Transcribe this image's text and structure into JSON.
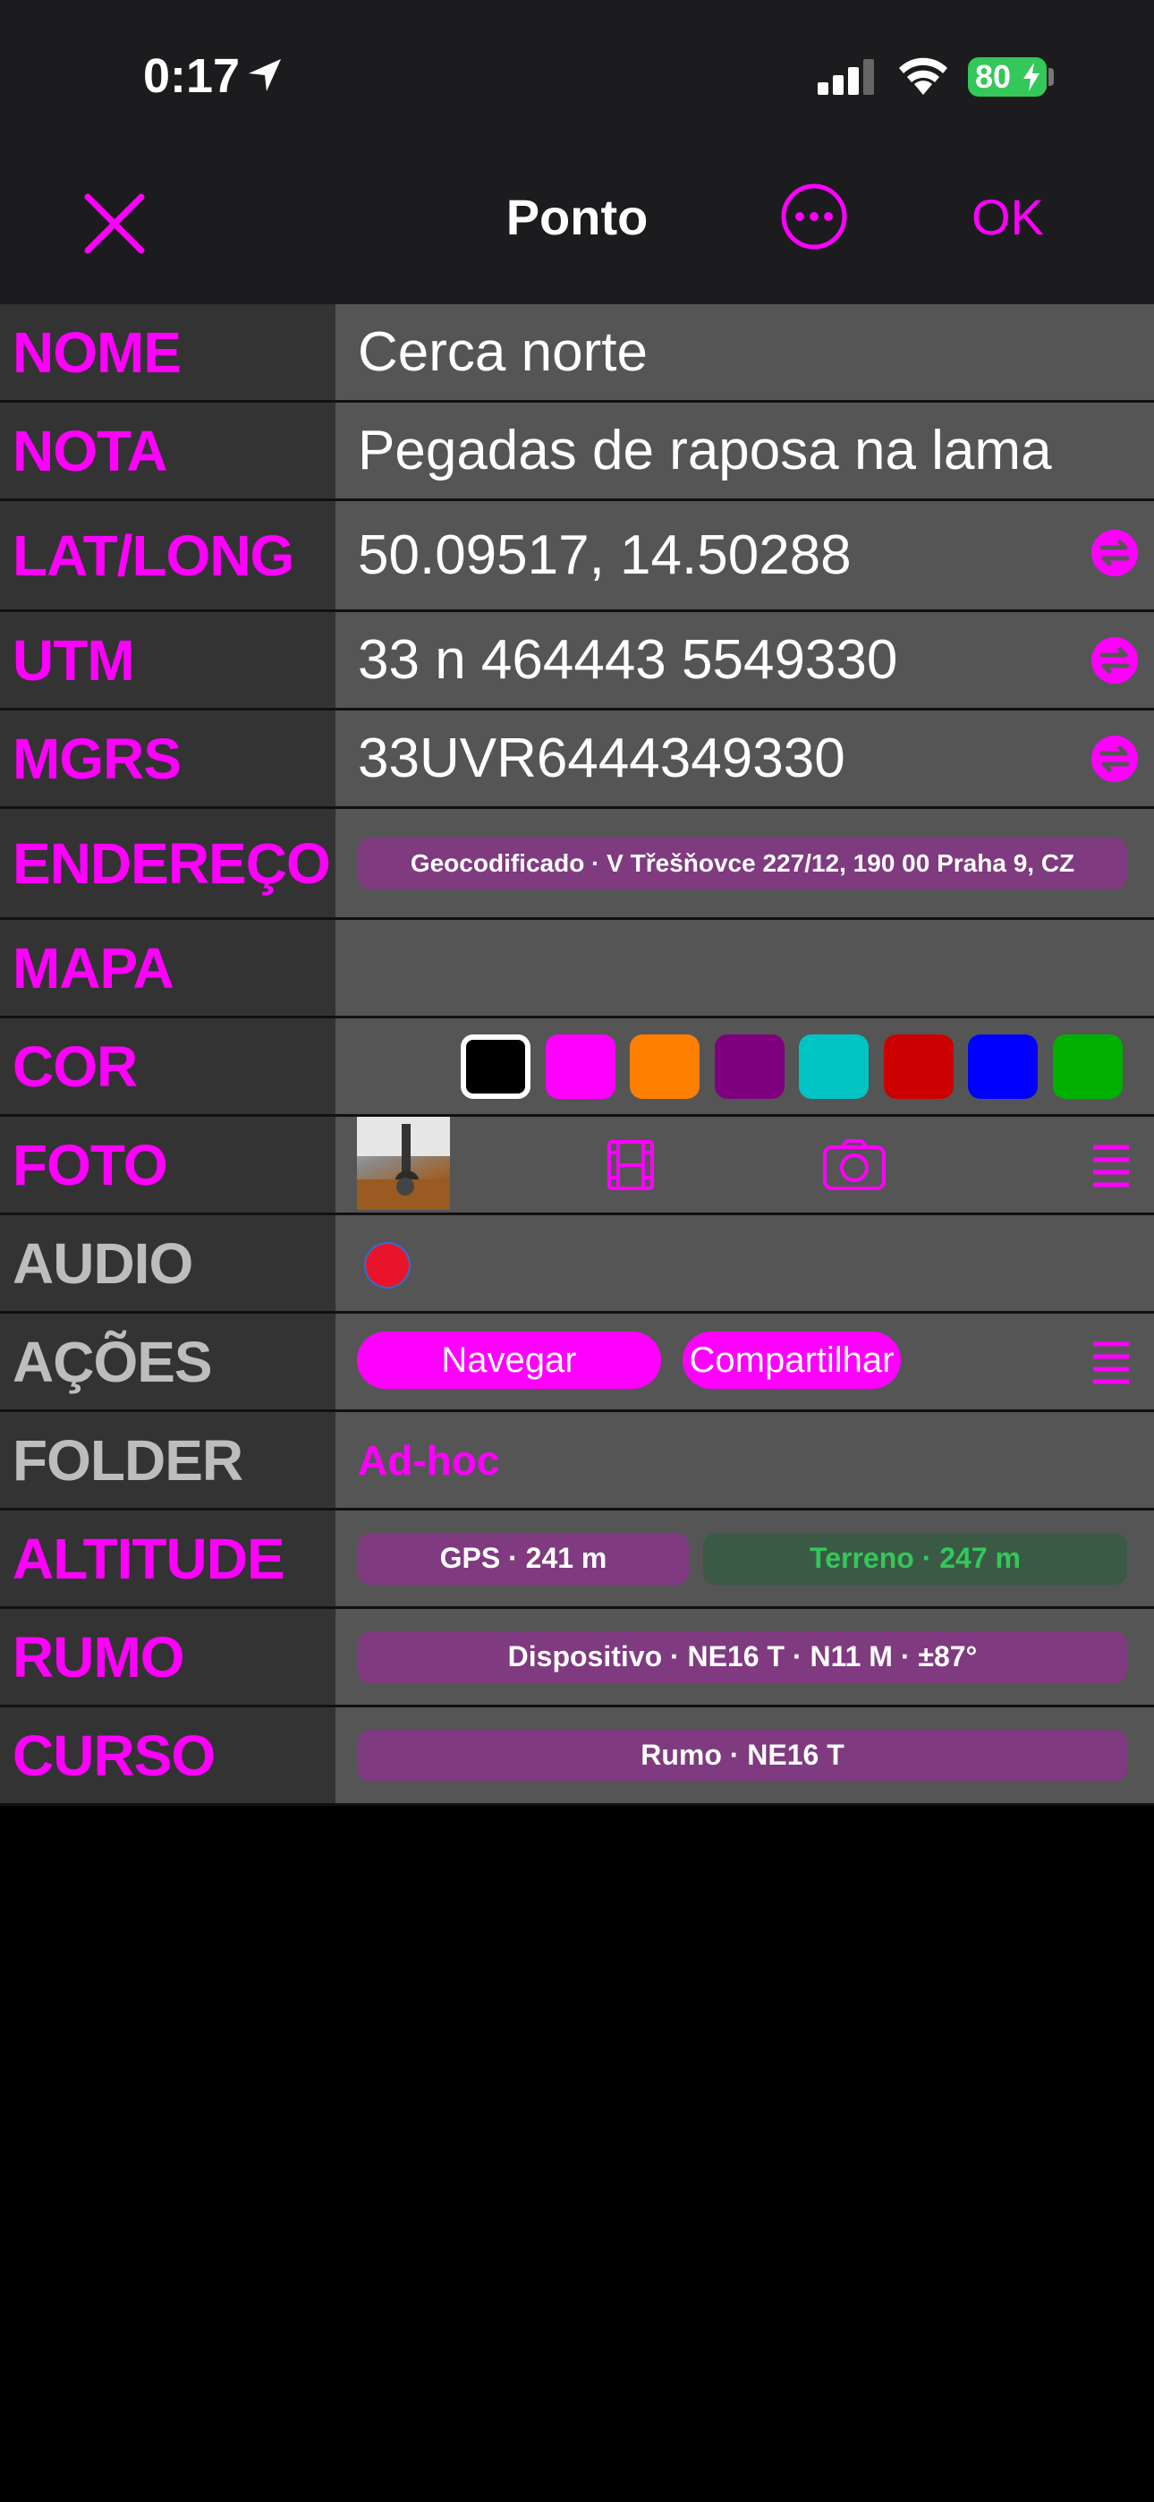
{
  "status": {
    "time": "0:17",
    "battery": "80"
  },
  "nav": {
    "title": "Ponto",
    "ok_label": "OK"
  },
  "rows": {
    "nome": {
      "label": "NOME",
      "value": "Cerca norte"
    },
    "nota": {
      "label": "NOTA",
      "value": "Pegadas de raposa na lama"
    },
    "latlong": {
      "label": "LAT/LONG",
      "value": "50.09517, 14.50288"
    },
    "utm": {
      "label": "UTM",
      "value": "33 n 464443 5549330"
    },
    "mgrs": {
      "label": "MGRS",
      "value": "33UVR6444349330"
    },
    "endereco": {
      "label": "ENDEREÇO",
      "value": "Geocodificado · V Třešňovce 227/12, 190 00 Praha 9, CZ"
    },
    "mapa": {
      "label": "MAPA"
    },
    "cor": {
      "label": "COR",
      "colors": [
        "#000000",
        "#ff00ff",
        "#ff7f00",
        "#7f007f",
        "#00c4c4",
        "#cc0000",
        "#0000ff",
        "#00b000"
      ],
      "selected_index": 0
    },
    "foto": {
      "label": "FOTO"
    },
    "audio": {
      "label": "AUDIO"
    },
    "acoes": {
      "label": "AÇÕES",
      "navegar": "Navegar",
      "compartilhar": "Compartilhar"
    },
    "folder": {
      "label": "FOLDER",
      "value": "Ad-hoc"
    },
    "altitude": {
      "label": "ALTITUDE",
      "gps": "GPS · 241 m",
      "terreno": "Terreno · 247 m"
    },
    "rumo": {
      "label": "RUMO",
      "value": "Dispositivo · NE16 T · N11 M · ±87°"
    },
    "curso": {
      "label": "CURSO",
      "value": "Rumo · NE16 T"
    }
  },
  "colors": {
    "accent": "#ff00ff",
    "label_bg": "#333333",
    "value_bg": "#555555",
    "pill_bg": "#7f3a80",
    "green_text": "#34c759"
  }
}
